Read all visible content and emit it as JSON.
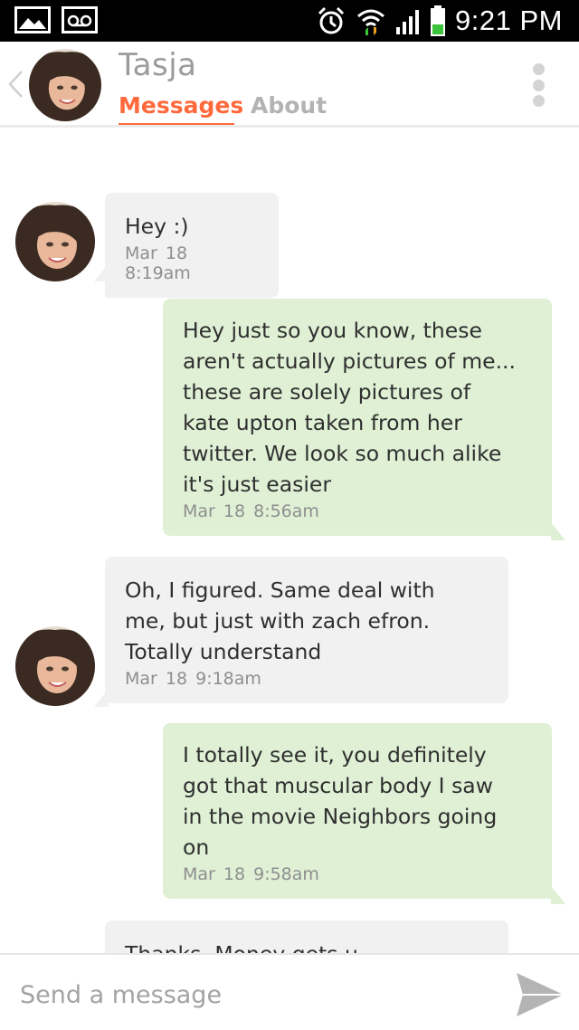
{
  "status_bar": {
    "time": "9:21 PM",
    "icons": [
      "gallery-icon",
      "voicemail-icon",
      "alarm-icon",
      "wifi-icon",
      "signal-icon",
      "battery-icon"
    ]
  },
  "header": {
    "contact_name": "Tasja",
    "tabs": [
      {
        "label": "Messages",
        "active": true
      },
      {
        "label": "About",
        "active": false
      }
    ],
    "accent_color": "#ff6a3d"
  },
  "messages": [
    {
      "direction": "incoming",
      "lines": [
        "Hey :)"
      ],
      "timestamp": "Mar 18  8:19am"
    },
    {
      "direction": "outgoing",
      "lines": [
        "Hey just so you know, these",
        "aren't actually pictures of me...",
        "these are solely pictures of",
        "kate upton taken from her",
        "twitter. We look so much alike",
        "it's just easier"
      ],
      "timestamp": "Mar 18  8:56am"
    },
    {
      "direction": "incoming",
      "lines": [
        "Oh,  I figured. Same deal with",
        "me, but just with zach efron.",
        "Totally understand"
      ],
      "timestamp": "Mar 18  9:18am"
    },
    {
      "direction": "outgoing",
      "lines": [
        "I totally see it, you definitely",
        "got that muscular body I saw",
        "in the movie Neighbors going",
        "on"
      ],
      "timestamp": "Mar 18  9:58am"
    },
    {
      "direction": "incoming",
      "lines": [
        "Thanks. Money gets u"
      ],
      "timestamp": ""
    }
  ],
  "composer": {
    "placeholder": "Send a message"
  },
  "colors": {
    "incoming_bubble": "#f1f1f1",
    "outgoing_bubble": "#dff0d5"
  }
}
